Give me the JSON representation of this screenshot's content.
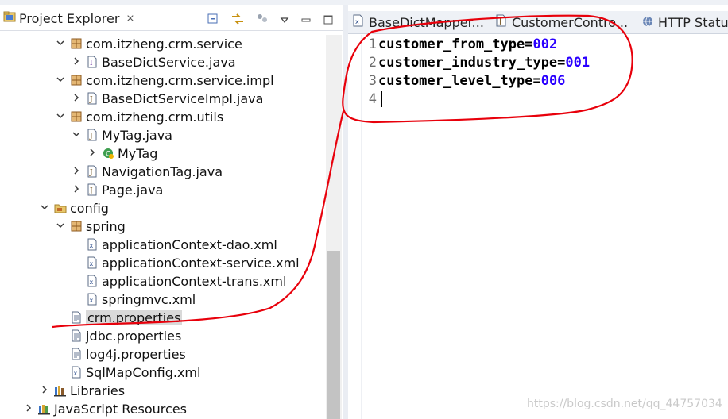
{
  "explorer": {
    "title": "Project Explorer",
    "close_glyph": "⨯",
    "tools": [
      "collapse-all-icon",
      "link-with-editor-icon",
      "view-menu-icon",
      "minimize-icon",
      "maximize-icon"
    ],
    "tree": [
      {
        "label": "com.itzheng.crm.service",
        "indent": 1,
        "twisty": "expanded",
        "icon": "package-icon"
      },
      {
        "label": "BaseDictService.java",
        "indent": 2,
        "twisty": "collapsed",
        "icon": "java-interface-file-icon"
      },
      {
        "label": "com.itzheng.crm.service.impl",
        "indent": 1,
        "twisty": "expanded",
        "icon": "package-icon"
      },
      {
        "label": "BaseDictServiceImpl.java",
        "indent": 2,
        "twisty": "collapsed",
        "icon": "java-file-icon"
      },
      {
        "label": "com.itzheng.crm.utils",
        "indent": 1,
        "twisty": "expanded",
        "icon": "package-icon"
      },
      {
        "label": "MyTag.java",
        "indent": 2,
        "twisty": "expanded",
        "icon": "java-file-icon"
      },
      {
        "label": "MyTag",
        "indent": 3,
        "twisty": "collapsed",
        "icon": "class-icon"
      },
      {
        "label": "NavigationTag.java",
        "indent": 2,
        "twisty": "collapsed",
        "icon": "java-file-icon"
      },
      {
        "label": "Page.java",
        "indent": 2,
        "twisty": "collapsed",
        "icon": "java-file-icon"
      },
      {
        "label": "config",
        "indent": 0,
        "twisty": "expanded",
        "icon": "source-folder-icon"
      },
      {
        "label": "spring",
        "indent": 1,
        "twisty": "expanded",
        "icon": "package-icon"
      },
      {
        "label": "applicationContext-dao.xml",
        "indent": 2,
        "twisty": "none",
        "icon": "xml-file-icon"
      },
      {
        "label": "applicationContext-service.xml",
        "indent": 2,
        "twisty": "none",
        "icon": "xml-file-icon"
      },
      {
        "label": "applicationContext-trans.xml",
        "indent": 2,
        "twisty": "none",
        "icon": "xml-file-icon"
      },
      {
        "label": "springmvc.xml",
        "indent": 2,
        "twisty": "none",
        "icon": "xml-file-icon"
      },
      {
        "label": "crm.properties",
        "indent": 1,
        "twisty": "none",
        "icon": "properties-file-icon",
        "selected": true
      },
      {
        "label": "jdbc.properties",
        "indent": 1,
        "twisty": "none",
        "icon": "properties-file-icon"
      },
      {
        "label": "log4j.properties",
        "indent": 1,
        "twisty": "none",
        "icon": "properties-file-icon"
      },
      {
        "label": "SqlMapConfig.xml",
        "indent": 1,
        "twisty": "none",
        "icon": "xml-file-icon"
      },
      {
        "label": "Libraries",
        "indent": 0,
        "twisty": "collapsed",
        "icon": "libraries-icon"
      },
      {
        "label": "JavaScript Resources",
        "indent": -1,
        "twisty": "collapsed",
        "icon": "javascript-resources-icon"
      }
    ]
  },
  "editor": {
    "tabs": [
      {
        "label": "BaseDictMapper...",
        "icon": "xml-file-icon"
      },
      {
        "label": "CustomerContro...",
        "icon": "java-file-icon"
      },
      {
        "label": "HTTP Status",
        "icon": "globe-icon"
      }
    ],
    "lines": [
      {
        "number": "1",
        "key": "customer_from_type=",
        "value": "002"
      },
      {
        "number": "2",
        "key": "customer_industry_type=",
        "value": "001"
      },
      {
        "number": "3",
        "key": "customer_level_type=",
        "value": "006"
      },
      {
        "number": "4",
        "key": "",
        "value": "",
        "caret": true
      }
    ]
  },
  "watermark": "https://blog.csdn.net/qq_44757034",
  "colors": {
    "annotation": "#e8000b",
    "property_value": "#2a00ff",
    "selection": "#d9d9d9"
  }
}
